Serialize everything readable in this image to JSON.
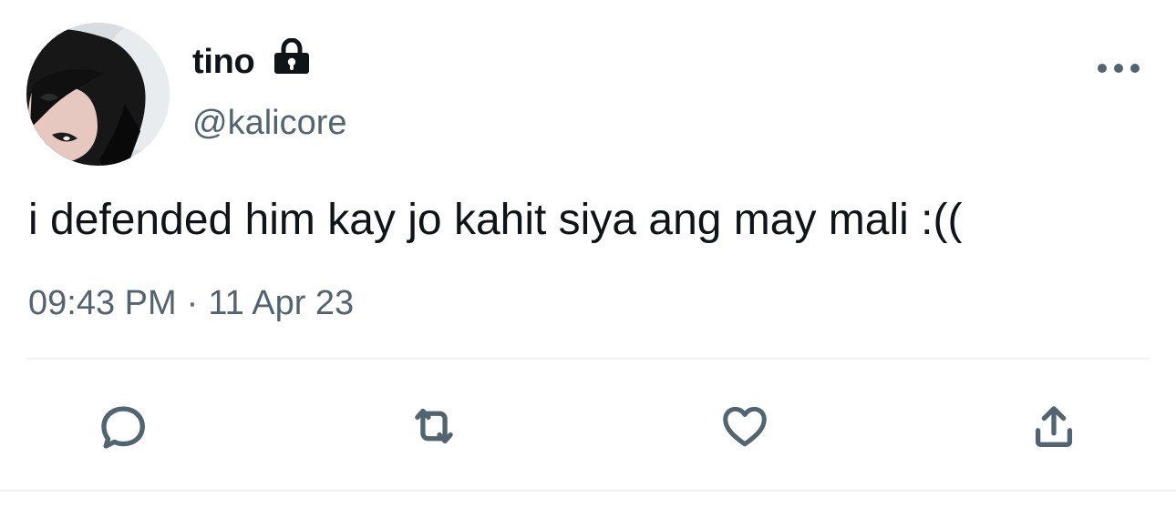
{
  "tweet": {
    "author": {
      "display_name": "tino",
      "handle": "@kalicore",
      "protected_icon": "lock-icon",
      "avatar": "avatar"
    },
    "text": "i defended him kay jo kahit siya ang may mali :((",
    "time": "09:43 PM",
    "separator": "·",
    "date": "11 Apr 23",
    "more_icon": "more-horizontal-icon",
    "actions": [
      {
        "name": "reply",
        "icon": "reply-icon"
      },
      {
        "name": "retweet",
        "icon": "retweet-icon"
      },
      {
        "name": "like",
        "icon": "heart-icon"
      },
      {
        "name": "share",
        "icon": "share-icon"
      }
    ]
  },
  "colors": {
    "text_primary": "#0f1419",
    "text_secondary": "#536471",
    "divider": "#eff3f4",
    "icon": "#536471"
  }
}
